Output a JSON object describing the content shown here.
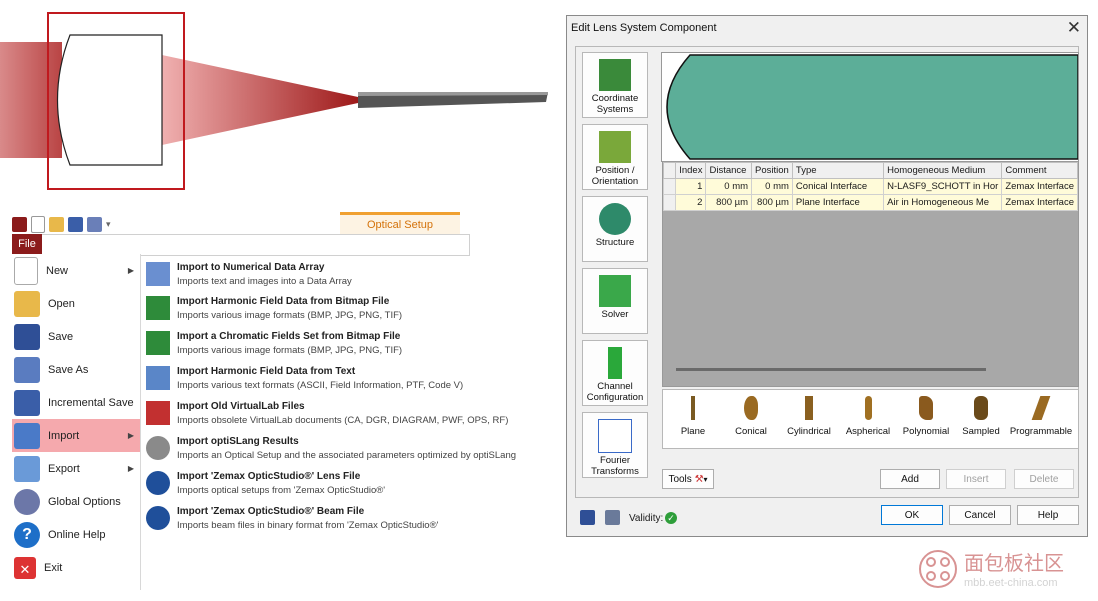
{
  "ribbon": {
    "tab_label": "Optical Setup",
    "file_label": "File"
  },
  "file_menu": {
    "items": [
      {
        "label": "New",
        "icon": "new-icon",
        "has_submenu": true
      },
      {
        "label": "Open",
        "icon": "open-folder-icon",
        "has_submenu": false
      },
      {
        "label": "Save",
        "icon": "save-icon",
        "has_submenu": false
      },
      {
        "label": "Save As",
        "icon": "save-as-icon",
        "has_submenu": false
      },
      {
        "label": "Incremental Save",
        "icon": "incremental-save-icon",
        "has_submenu": false
      },
      {
        "label": "Import",
        "icon": "import-icon",
        "has_submenu": true,
        "active": true
      },
      {
        "label": "Export",
        "icon": "export-icon",
        "has_submenu": true
      },
      {
        "label": "Global Options",
        "icon": "gears-icon",
        "has_submenu": false
      },
      {
        "label": "Online Help",
        "icon": "help-icon",
        "has_submenu": false
      },
      {
        "label": "Exit",
        "icon": "exit-icon",
        "has_submenu": false
      }
    ],
    "import_options": [
      {
        "title": "Import to Numerical Data Array",
        "description": "Imports text and images into a Data Array"
      },
      {
        "title": "Import Harmonic Field Data from Bitmap File",
        "description": "Imports various image formats (BMP, JPG, PNG, TIF)"
      },
      {
        "title": "Import a Chromatic Fields Set from Bitmap File",
        "description": "Imports various image formats (BMP, JPG, PNG, TIF)"
      },
      {
        "title": "Import Harmonic Field Data from Text",
        "description": "Imports various text formats (ASCII, Field Information, PTF, Code V)"
      },
      {
        "title": "Import Old VirtualLab Files",
        "description": "Imports obsolete VirtualLab documents (CA, DGR, DIAGRAM, PWF, OPS, RF)"
      },
      {
        "title": "Import optiSLang Results",
        "description": "Imports an Optical Setup and the associated parameters optimized by optiSLang"
      },
      {
        "title": "Import 'Zemax OpticStudio®' Lens File",
        "description": "Imports optical setups from 'Zemax OpticStudio®'"
      },
      {
        "title": "Import 'Zemax OpticStudio®' Beam File",
        "description": "Imports beam files in binary format from 'Zemax OpticStudio®'"
      }
    ]
  },
  "dialog": {
    "title": "Edit Lens System Component",
    "close_label": "✕",
    "side_buttons": [
      {
        "label_line1": "Coordinate",
        "label_line2": "Systems"
      },
      {
        "label_line1": "Position /",
        "label_line2": "Orientation"
      },
      {
        "label_line1": "Structure",
        "label_line2": ""
      },
      {
        "label_line1": "Solver",
        "label_line2": ""
      },
      {
        "label_line1": "Channel",
        "label_line2": "Configuration"
      },
      {
        "label_line1": "Fourier",
        "label_line2": "Transforms"
      }
    ],
    "table": {
      "columns": [
        "Index",
        "Distance",
        "Position",
        "Type",
        "Homogeneous Medium",
        "Comment"
      ],
      "rows": [
        {
          "index": "1",
          "distance": "0 mm",
          "position": "0 mm",
          "type": "Conical Interface",
          "medium": "N-LASF9_SCHOTT in Hor",
          "comment": "Zemax Interface"
        },
        {
          "index": "2",
          "distance": "800 µm",
          "position": "800 µm",
          "type": "Plane Interface",
          "medium": "Air in Homogeneous Me",
          "comment": "Zemax Interface"
        }
      ]
    },
    "lens_types": [
      "Plane",
      "Conical",
      "Cylindrical",
      "Aspherical",
      "Polynomial",
      "Sampled",
      "Programmable"
    ],
    "tools_label": "Tools",
    "add_label": "Add",
    "insert_label": "Insert",
    "delete_label": "Delete",
    "validity_label": "Validity:",
    "ok_label": "OK",
    "cancel_label": "Cancel",
    "help_label": "Help",
    "preview_color": "#5cae98"
  },
  "watermark": {
    "text": "面包板社区",
    "url": "mbb.eet-china.com"
  }
}
